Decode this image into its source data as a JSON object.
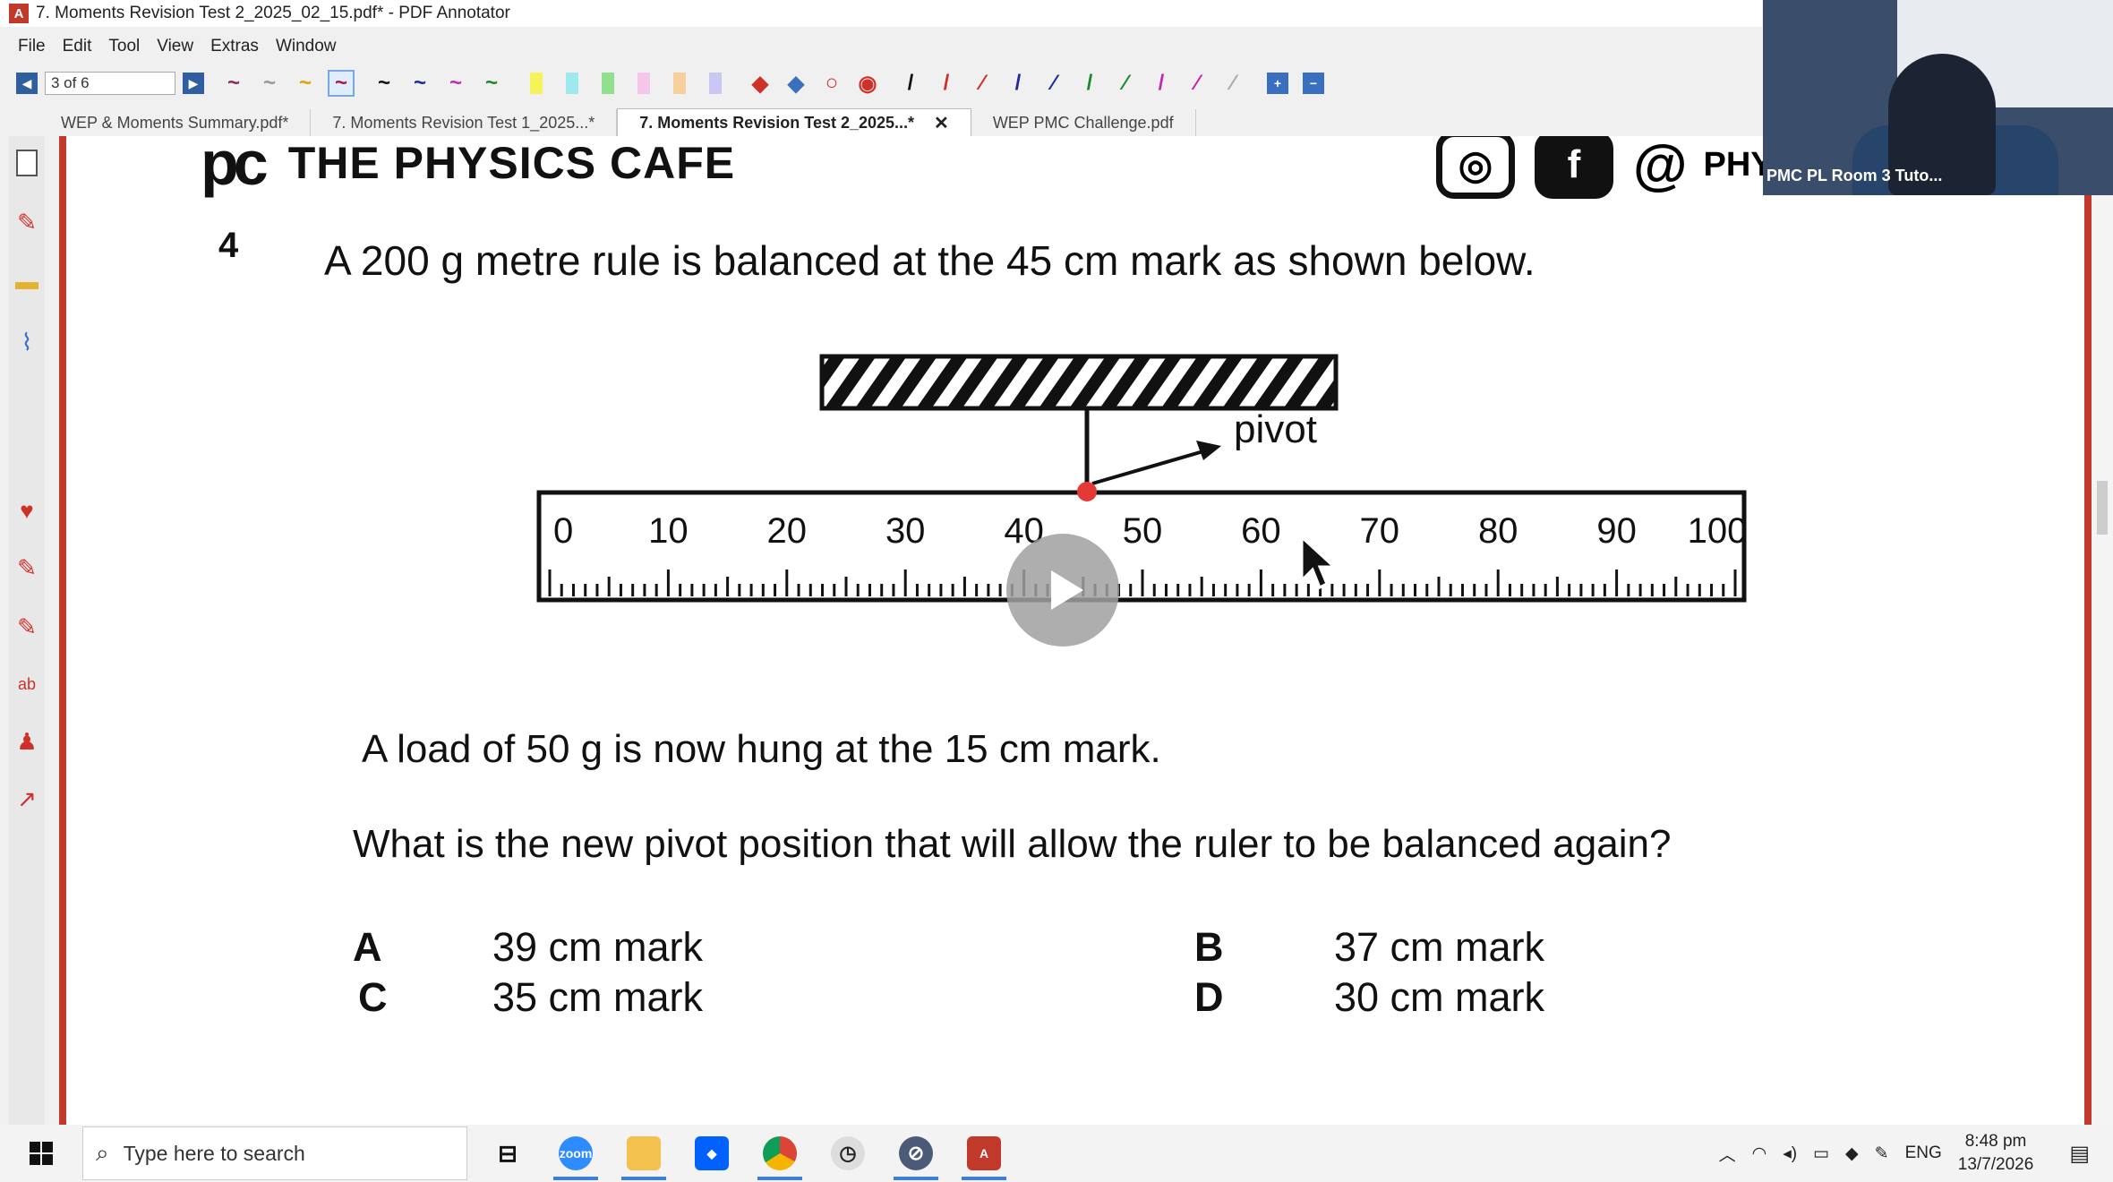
{
  "window": {
    "title": "7. Moments Revision Test 2_2025_02_15.pdf* - PDF Annotator",
    "app_icon": "pdf-annotator-icon"
  },
  "menu": [
    "File",
    "Edit",
    "Tool",
    "View",
    "Extras",
    "Window"
  ],
  "toolbar": {
    "page_indicator": "3 of 6",
    "prev_icon": "prev-page-icon",
    "next_icon": "next-page-icon"
  },
  "tabs": [
    {
      "label": "WEP & Moments Summary.pdf*"
    },
    {
      "label": "7. Moments Revision Test 1_2025...*"
    },
    {
      "label": "7. Moments Revision Test 2_2025...*",
      "active": true,
      "close": "✕"
    },
    {
      "label": "WEP PMC Challenge.pdf"
    }
  ],
  "document": {
    "header": {
      "logo": "pc",
      "brand": "THE PHYSICS CAFE",
      "social_at": "@",
      "social_handle": "PHY"
    },
    "question": {
      "number": "4",
      "text": "A 200 g metre rule is balanced at the 45 cm mark as shown below.",
      "pivot_label": "pivot",
      "ruler_marks": [
        "0",
        "10",
        "20",
        "30",
        "40",
        "50",
        "60",
        "70",
        "80",
        "90",
        "100"
      ],
      "load_text": "A load of 50 g is now hung at the 15 cm mark.",
      "ask_text": "What is the new pivot position that will allow the ruler to be balanced again?",
      "options": [
        {
          "letter": "A",
          "text": "39 cm mark"
        },
        {
          "letter": "B",
          "text": "37 cm mark"
        },
        {
          "letter": "C",
          "text": "35 cm mark"
        },
        {
          "letter": "D",
          "text": "30 cm mark"
        }
      ]
    }
  },
  "webcam": {
    "label": "PMC PL Room 3 Tuto..."
  },
  "taskbar": {
    "search_placeholder": "Type here to search",
    "apps": [
      "task-view-icon",
      "zoom-icon",
      "file-explorer-icon",
      "dropbox-icon",
      "chrome-icon",
      "clock-app-icon",
      "safari-icon",
      "pdf-annotator-icon"
    ],
    "tray": {
      "language": "ENG",
      "time": "8:48 pm",
      "date": "13/7/2026"
    }
  },
  "colors": {
    "accent_red": "#c0392b",
    "nav_blue": "#2f5f9e",
    "pivot_dot": "#e53935"
  }
}
